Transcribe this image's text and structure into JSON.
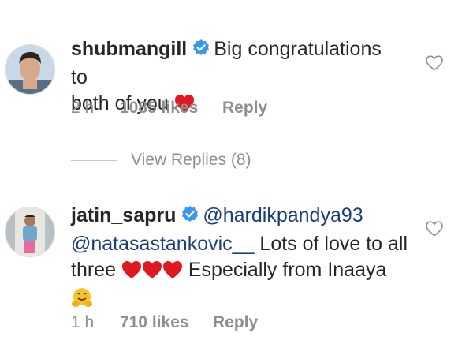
{
  "comments": [
    {
      "username": "shubmangill",
      "text_before": "Big congratulations to",
      "text_line2": "both of you",
      "time": "2 h",
      "likes": "1085 likes",
      "reply": "Reply",
      "avatar_icon": "user-photo-shubmangill"
    },
    {
      "username": "jatin_sapru",
      "mention1": "@hardikpandya93",
      "mention2": "@natasastankovic__",
      "text_after_mention2": " Lots of love to all",
      "text_line3_start": "three",
      "text_line3_end": " Especially from Inaaya",
      "time": "1 h",
      "likes": "710 likes",
      "reply": "Reply",
      "avatar_icon": "user-photo-jatin-sapru"
    }
  ],
  "view_replies": "View Replies (8)",
  "colors": {
    "heart_red": "#e0181f",
    "verified_blue": "#3897f0",
    "mention_blue": "#1a3d7c",
    "meta_gray": "#8e8e8e"
  }
}
